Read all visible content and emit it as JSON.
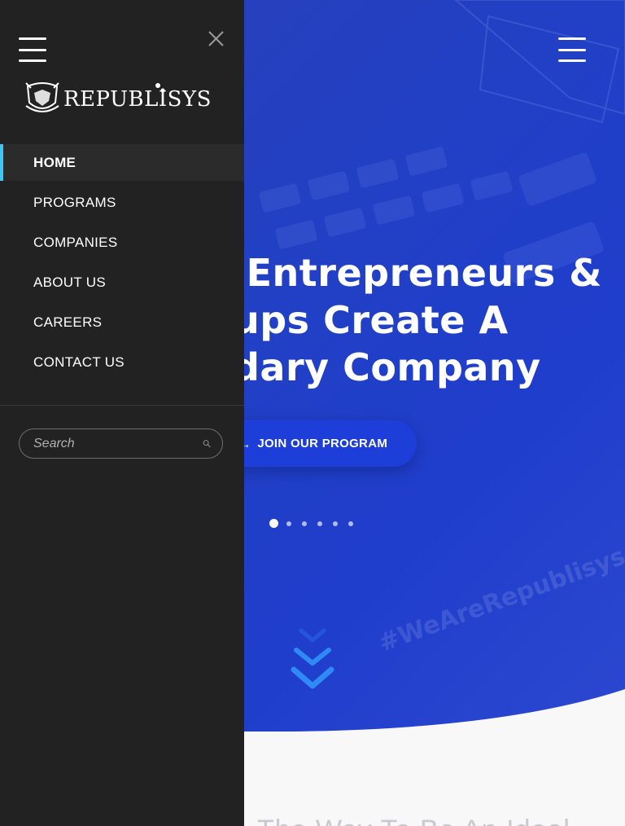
{
  "sidebar": {
    "logo_text": "REPUBLISYS",
    "nav": [
      {
        "label": "HOME",
        "active": true
      },
      {
        "label": "PROGRAMS",
        "active": false
      },
      {
        "label": "COMPANIES",
        "active": false
      },
      {
        "label": "ABOUT US",
        "active": false
      },
      {
        "label": "CAREERS",
        "active": false
      },
      {
        "label": "CONTACT US",
        "active": false
      }
    ],
    "search": {
      "placeholder": "Search",
      "value": ""
    },
    "accent_color": "#3ec6f5",
    "background_color": "#222222"
  },
  "hero": {
    "headline_lines": [
      "o Entrepreneurs &",
      "ups Create A",
      "dary Company"
    ],
    "cta_label": "JOIN OUR PROGRAM",
    "slides_total": 6,
    "active_slide": 1,
    "background_color": "#2240c4",
    "watermark_text": "#WeAreRepublisys"
  },
  "below": {
    "partial_heading": "The Way To Be An Ideal"
  },
  "icons": {
    "menu": "hamburger-icon",
    "close": "close-icon",
    "search": "search-icon",
    "scroll": "double-chevron-down-icon",
    "cta": "arrow-right-icon"
  }
}
